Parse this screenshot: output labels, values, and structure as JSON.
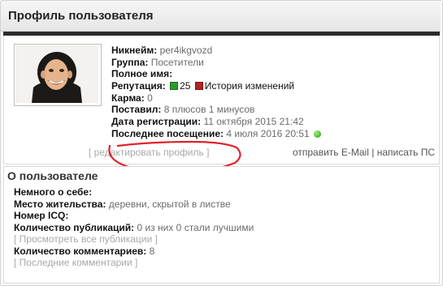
{
  "title": "Профиль пользователя",
  "profile": {
    "nickname_label": "Никнейм:",
    "nickname": "per4ikgvozd",
    "group_label": "Группа:",
    "group": "Посетители",
    "fullname_label": "Полное имя:",
    "reputation_label": "Репутация:",
    "reputation_value": "25",
    "reputation_history": "История изменений",
    "karma_label": "Карма:",
    "karma": "0",
    "rated_label": "Поставил:",
    "rated": "8 плюсов 1 минусов",
    "registered_label": "Дата регистрации:",
    "registered": "11 октября 2015 21:42",
    "last_visit_label": "Последнее посещение:",
    "last_visit": "4 июля 2016 20:51",
    "edit_profile": "[ редактировать профиль ]",
    "send_email": "отправить E-Mail",
    "separator": "|",
    "write_pm": "написать ПС"
  },
  "about": {
    "title": "О пользователе",
    "about_self_label": "Немного о себе:",
    "location_label": "Место жительства:",
    "location": "деревни, скрытой в листве",
    "icq_label": "Номер ICQ:",
    "publications_label": "Количество публикаций:",
    "publications": "0 из них 0 стали лучшими",
    "view_publications": "[ Просмотреть все публикации ]",
    "comments_label": "Количество комментариев:",
    "comments": "8",
    "last_comments": "[ Последние комментарии ]"
  },
  "colors": {
    "rep_up": "#2e9a2e",
    "rep_down": "#b02424",
    "online": "#1e9b12",
    "annotation": "#e0202a"
  },
  "icons": [
    "avatar-photo",
    "rep-up-icon",
    "rep-down-icon",
    "online-status-icon"
  ]
}
